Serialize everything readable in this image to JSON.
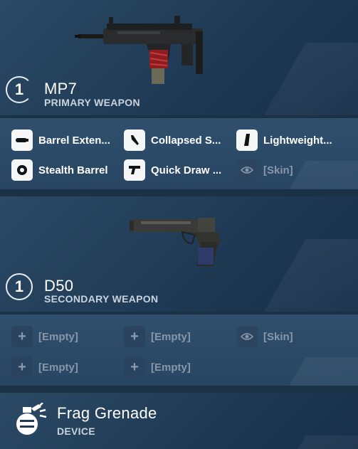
{
  "primary": {
    "slot_number": "1",
    "name": "MP7",
    "type": "PRIMARY WEAPON",
    "attachments": [
      {
        "label": "Barrel Exten...",
        "icon": "barrel-extender-icon"
      },
      {
        "label": "Collapsed S...",
        "icon": "collapsed-stock-icon"
      },
      {
        "label": "Lightweight...",
        "icon": "lightweight-mag-icon"
      },
      {
        "label": "Stealth Barrel",
        "icon": "stealth-barrel-icon"
      },
      {
        "label": "Quick Draw ...",
        "icon": "quick-draw-grip-icon"
      },
      {
        "label": "[Skin]",
        "icon": "eye-icon"
      }
    ]
  },
  "secondary": {
    "slot_number": "1",
    "name": "D50",
    "type": "SECONDARY WEAPON",
    "attachments": [
      {
        "label": "[Empty]",
        "icon": "plus-icon"
      },
      {
        "label": "[Empty]",
        "icon": "plus-icon"
      },
      {
        "label": "[Skin]",
        "icon": "eye-icon"
      },
      {
        "label": "[Empty]",
        "icon": "plus-icon"
      },
      {
        "label": "[Empty]",
        "icon": "plus-icon"
      }
    ]
  },
  "device": {
    "name": "Frag Grenade",
    "type": "DEVICE",
    "icon": "frag-grenade-icon"
  }
}
